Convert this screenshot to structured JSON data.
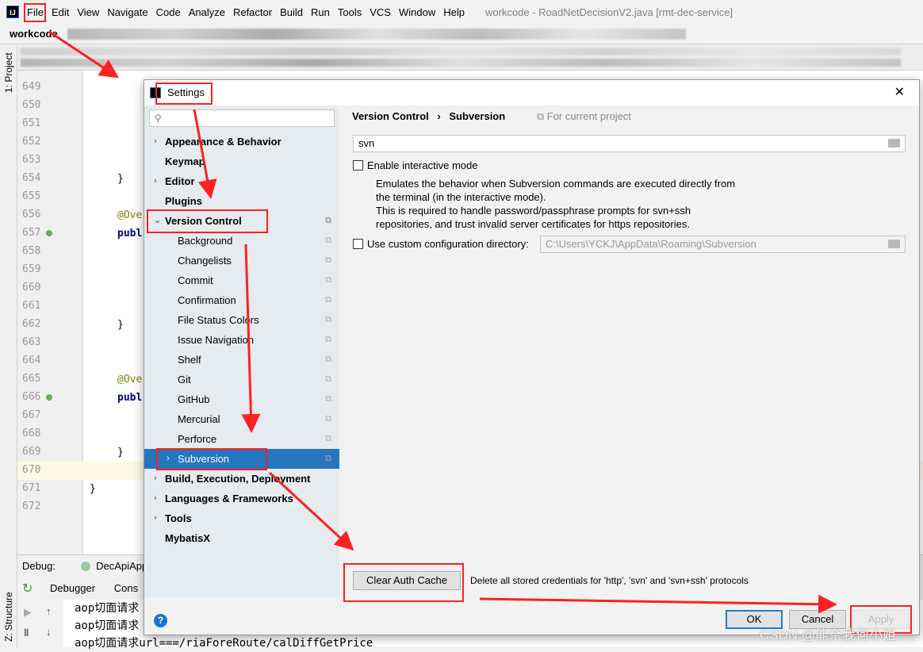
{
  "menubar": {
    "logo": "IJ",
    "items": [
      "File",
      "Edit",
      "View",
      "Navigate",
      "Code",
      "Analyze",
      "Refactor",
      "Build",
      "Run",
      "Tools",
      "VCS",
      "Window",
      "Help"
    ],
    "title": "workcode - RoadNetDecisionV2.java [rmt-dec-service]"
  },
  "navbar": {
    "project": "workcode"
  },
  "toolwindows": {
    "project": "1: Project",
    "structure": "Z: Structure"
  },
  "editor": {
    "line_numbers": [
      "649",
      "650",
      "651",
      "652",
      "653",
      "654",
      "655",
      "656",
      "657",
      "658",
      "659",
      "660",
      "661",
      "662",
      "663",
      "664",
      "665",
      "666",
      "667",
      "668",
      "669",
      "670",
      "671",
      "672"
    ],
    "code": {
      "l654": "}",
      "l656": "@Ove",
      "l657": "publ",
      "l662": "}",
      "l665": "@Ove",
      "l666": "publ",
      "l669": "}",
      "l671": "}"
    }
  },
  "debug": {
    "label": "Debug:",
    "config": "DecApiAppli",
    "tabs": [
      "Debugger",
      "Cons"
    ],
    "console_lines": [
      "aop切面请求",
      "aop切面请求",
      "aop切面请求url===/riaForeRoute/calDiffGetPrice"
    ]
  },
  "dialog": {
    "title": "Settings",
    "search_placeholder": "",
    "tree": [
      {
        "label": "Appearance & Behavior",
        "level": 0,
        "expandable": true
      },
      {
        "label": "Keymap",
        "level": 0
      },
      {
        "label": "Editor",
        "level": 0,
        "expandable": true
      },
      {
        "label": "Plugins",
        "level": 0
      },
      {
        "label": "Version Control",
        "level": 0,
        "expanded": true
      },
      {
        "label": "Background",
        "level": 1
      },
      {
        "label": "Changelists",
        "level": 1
      },
      {
        "label": "Commit",
        "level": 1
      },
      {
        "label": "Confirmation",
        "level": 1
      },
      {
        "label": "File Status Colors",
        "level": 1
      },
      {
        "label": "Issue Navigation",
        "level": 1
      },
      {
        "label": "Shelf",
        "level": 1
      },
      {
        "label": "Git",
        "level": 1
      },
      {
        "label": "GitHub",
        "level": 1
      },
      {
        "label": "Mercurial",
        "level": 1
      },
      {
        "label": "Perforce",
        "level": 1
      },
      {
        "label": "Subversion",
        "level": 1,
        "selected": true
      },
      {
        "label": "Build, Execution, Deployment",
        "level": 0,
        "expandable": true
      },
      {
        "label": "Languages & Frameworks",
        "level": 0,
        "expandable": true
      },
      {
        "label": "Tools",
        "level": 0,
        "expandable": true
      },
      {
        "label": "MybatisX",
        "level": 0
      }
    ],
    "breadcrumb": {
      "parent": "Version Control",
      "sep": "›",
      "current": "Subversion",
      "scope": "For current project"
    },
    "svn_path": "svn",
    "interactive_mode": {
      "label": "Enable interactive mode",
      "checked": false,
      "description": [
        "Emulates the behavior when Subversion commands are executed directly from",
        "the terminal (in the interactive mode).",
        "This is required to handle password/passphrase prompts for svn+ssh",
        "repositories, and trust invalid server certificates for https repositories."
      ]
    },
    "custom_config": {
      "label": "Use custom configuration directory:",
      "checked": false,
      "value": "C:\\Users\\YCKJ\\AppData\\Roaming\\Subversion"
    },
    "clear_auth": {
      "label": "Clear Auth Cache",
      "description": "Delete all stored credentials for 'http', 'svn' and 'svn+ssh' protocols"
    },
    "buttons": {
      "ok": "OK",
      "cancel": "Cancel",
      "apply": "Apply",
      "help": "?"
    }
  },
  "watermark": "CSDN @能奈我何小姐",
  "colors": {
    "selection": "#2675bf",
    "annotation": "#ff2020",
    "annotation_text": "#808000",
    "keyword": "#000080"
  }
}
